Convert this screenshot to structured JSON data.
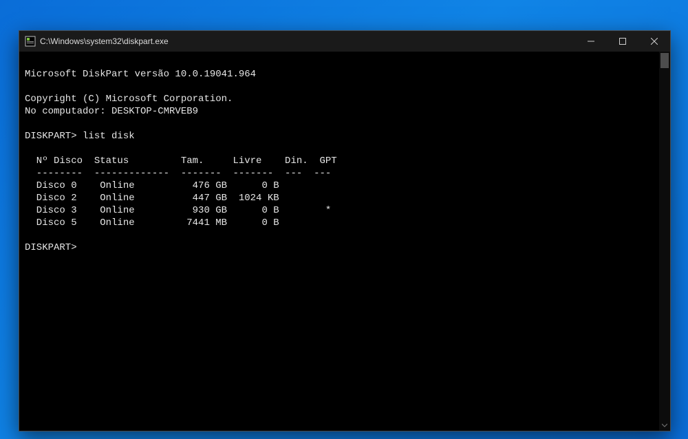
{
  "window": {
    "title": "C:\\Windows\\system32\\diskpart.exe"
  },
  "console": {
    "blank0": "",
    "version_line": "Microsoft DiskPart versão 10.0.19041.964",
    "blank1": "",
    "copyright": "Copyright (C) Microsoft Corporation.",
    "computer": "No computador: DESKTOP-CMRVEB9",
    "blank2": "",
    "prompt1": "DISKPART> list disk",
    "blank3": "",
    "header": "  Nº Disco  Status         Tam.     Livre    Din.  GPT",
    "divider": "  --------  -------------  -------  -------  ---  ---",
    "rows": [
      "  Disco 0    Online          476 GB      0 B            ",
      "  Disco 2    Online          447 GB  1024 KB            ",
      "  Disco 3    Online          930 GB      0 B        *   ",
      "  Disco 5    Online         7441 MB      0 B            "
    ],
    "blank4": "",
    "prompt2": "DISKPART>"
  },
  "chart_data": {
    "type": "table",
    "title": "DISKPART list disk",
    "columns": [
      "Nº Disco",
      "Status",
      "Tam.",
      "Livre",
      "Din.",
      "GPT"
    ],
    "rows": [
      {
        "disk": "Disco 0",
        "status": "Online",
        "size": "476 GB",
        "free": "0 B",
        "dyn": "",
        "gpt": ""
      },
      {
        "disk": "Disco 2",
        "status": "Online",
        "size": "447 GB",
        "free": "1024 KB",
        "dyn": "",
        "gpt": ""
      },
      {
        "disk": "Disco 3",
        "status": "Online",
        "size": "930 GB",
        "free": "0 B",
        "dyn": "",
        "gpt": "*"
      },
      {
        "disk": "Disco 5",
        "status": "Online",
        "size": "7441 MB",
        "free": "0 B",
        "dyn": "",
        "gpt": ""
      }
    ]
  }
}
